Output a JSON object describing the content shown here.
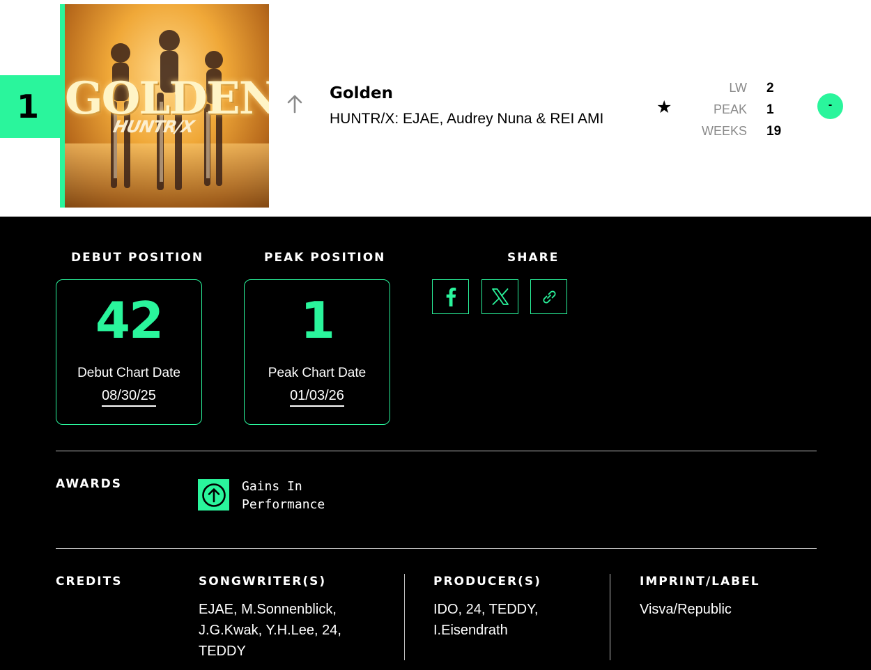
{
  "chart_row": {
    "rank": "1",
    "cover_title": "GOLDEN",
    "cover_artist": "HUNTR/X",
    "title": "Golden",
    "artist": "HUNTR/X: EJAE, Audrey Nuna & REI AMI",
    "stats": [
      {
        "label": "LW",
        "value": "2"
      },
      {
        "label": "PEAK",
        "value": "1"
      },
      {
        "label": "WEEKS",
        "value": "19"
      }
    ],
    "movement_badge": "-",
    "icons": {
      "trend": "arrow-up-icon",
      "star": "star-icon"
    }
  },
  "details": {
    "debut": {
      "heading": "DEBUT POSITION",
      "position": "42",
      "label": "Debut Chart Date",
      "date": "08/30/25"
    },
    "peak": {
      "heading": "PEAK POSITION",
      "position": "1",
      "label": "Peak Chart Date",
      "date": "01/03/26"
    },
    "share": {
      "heading": "SHARE",
      "buttons": [
        "facebook-icon",
        "x-icon",
        "link-icon"
      ]
    },
    "awards": {
      "heading": "AWARDS",
      "items": [
        {
          "line1": "Gains In",
          "line2": "Performance",
          "icon": "arrow-up-circle-icon"
        }
      ]
    },
    "credits": {
      "heading": "CREDITS",
      "songwriters": {
        "heading": "SONGWRITER(S)",
        "lines": [
          "EJAE, M.Sonnenblick,",
          "J.G.Kwak, Y.H.Lee, 24,",
          "TEDDY"
        ]
      },
      "producers": {
        "heading": "PRODUCER(S)",
        "lines": [
          "IDO, 24, TEDDY,",
          "I.Eisendrath"
        ]
      },
      "label": {
        "heading": "IMPRINT/LABEL",
        "lines": [
          "Visva/Republic"
        ]
      }
    }
  },
  "colors": {
    "accent": "#2af59c",
    "background": "#000000",
    "row_background": "#ffffff",
    "muted": "#8a8a8a"
  }
}
